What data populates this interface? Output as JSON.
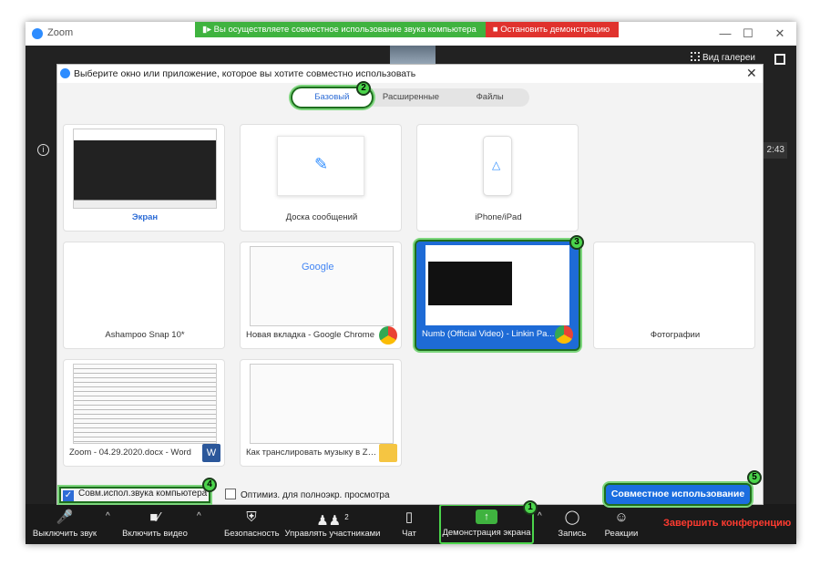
{
  "window": {
    "title": "Zoom",
    "minimize": "—",
    "maximize": "☐",
    "close": "✕"
  },
  "banner": {
    "sharing_sound": "Вы осуществляете совместное использование звука компьютера",
    "stop_demo": "Остановить демонстрацию"
  },
  "meeting": {
    "gallery_view": "Вид галереи",
    "clock": "2:43",
    "info": "i",
    "signal": "Zo"
  },
  "dialog": {
    "title": "Выберите окно или приложение, которое вы хотите совместно использовать",
    "close": "✕",
    "tabs": [
      {
        "label": "Базовый",
        "active": true
      },
      {
        "label": "Расширенные",
        "active": false
      },
      {
        "label": "Файлы",
        "active": false
      }
    ],
    "tiles": [
      {
        "label": "Экран"
      },
      {
        "label": "Доска сообщений"
      },
      {
        "label": "iPhone/iPad"
      },
      {
        "label": "Ashampoo Snap 10*"
      },
      {
        "label": "Новая вкладка - Google Chrome",
        "app_icon": "chrome-icon"
      },
      {
        "label": "Numb (Official Video) - Linkin Pa...",
        "app_icon": "chrome-icon",
        "selected": true
      },
      {
        "label": "Фотографии"
      },
      {
        "label": "Zoom - 04.29.2020.docx - Word",
        "app_icon": "word-icon"
      },
      {
        "label": "Как транслировать музыку в Zo...",
        "app_icon": "folder-icon"
      }
    ],
    "options": {
      "share_audio": {
        "label": "Совм.испол.звука компьютера",
        "checked": true
      },
      "optimize": {
        "label": "Оптимиз. для полноэкр. просмотра",
        "checked": false
      }
    },
    "share_button": "Совместное использование"
  },
  "badges": [
    "1",
    "2",
    "3",
    "4",
    "5"
  ],
  "toolbar": {
    "mute": "Выключить звук",
    "video": "Включить видео",
    "security": "Безопасность",
    "participants": "Управлять участниками",
    "participants_count": "2",
    "chat": "Чат",
    "share_screen": "Демонстрация экрана",
    "record": "Запись",
    "reactions": "Реакции",
    "end": "Завершить конференцию"
  },
  "colors": {
    "accent": "#2d8cff",
    "share_green": "#3fb33f",
    "stop_red": "#e0322d",
    "highlight": "#4bd44b",
    "end_red": "#ff3b30"
  }
}
